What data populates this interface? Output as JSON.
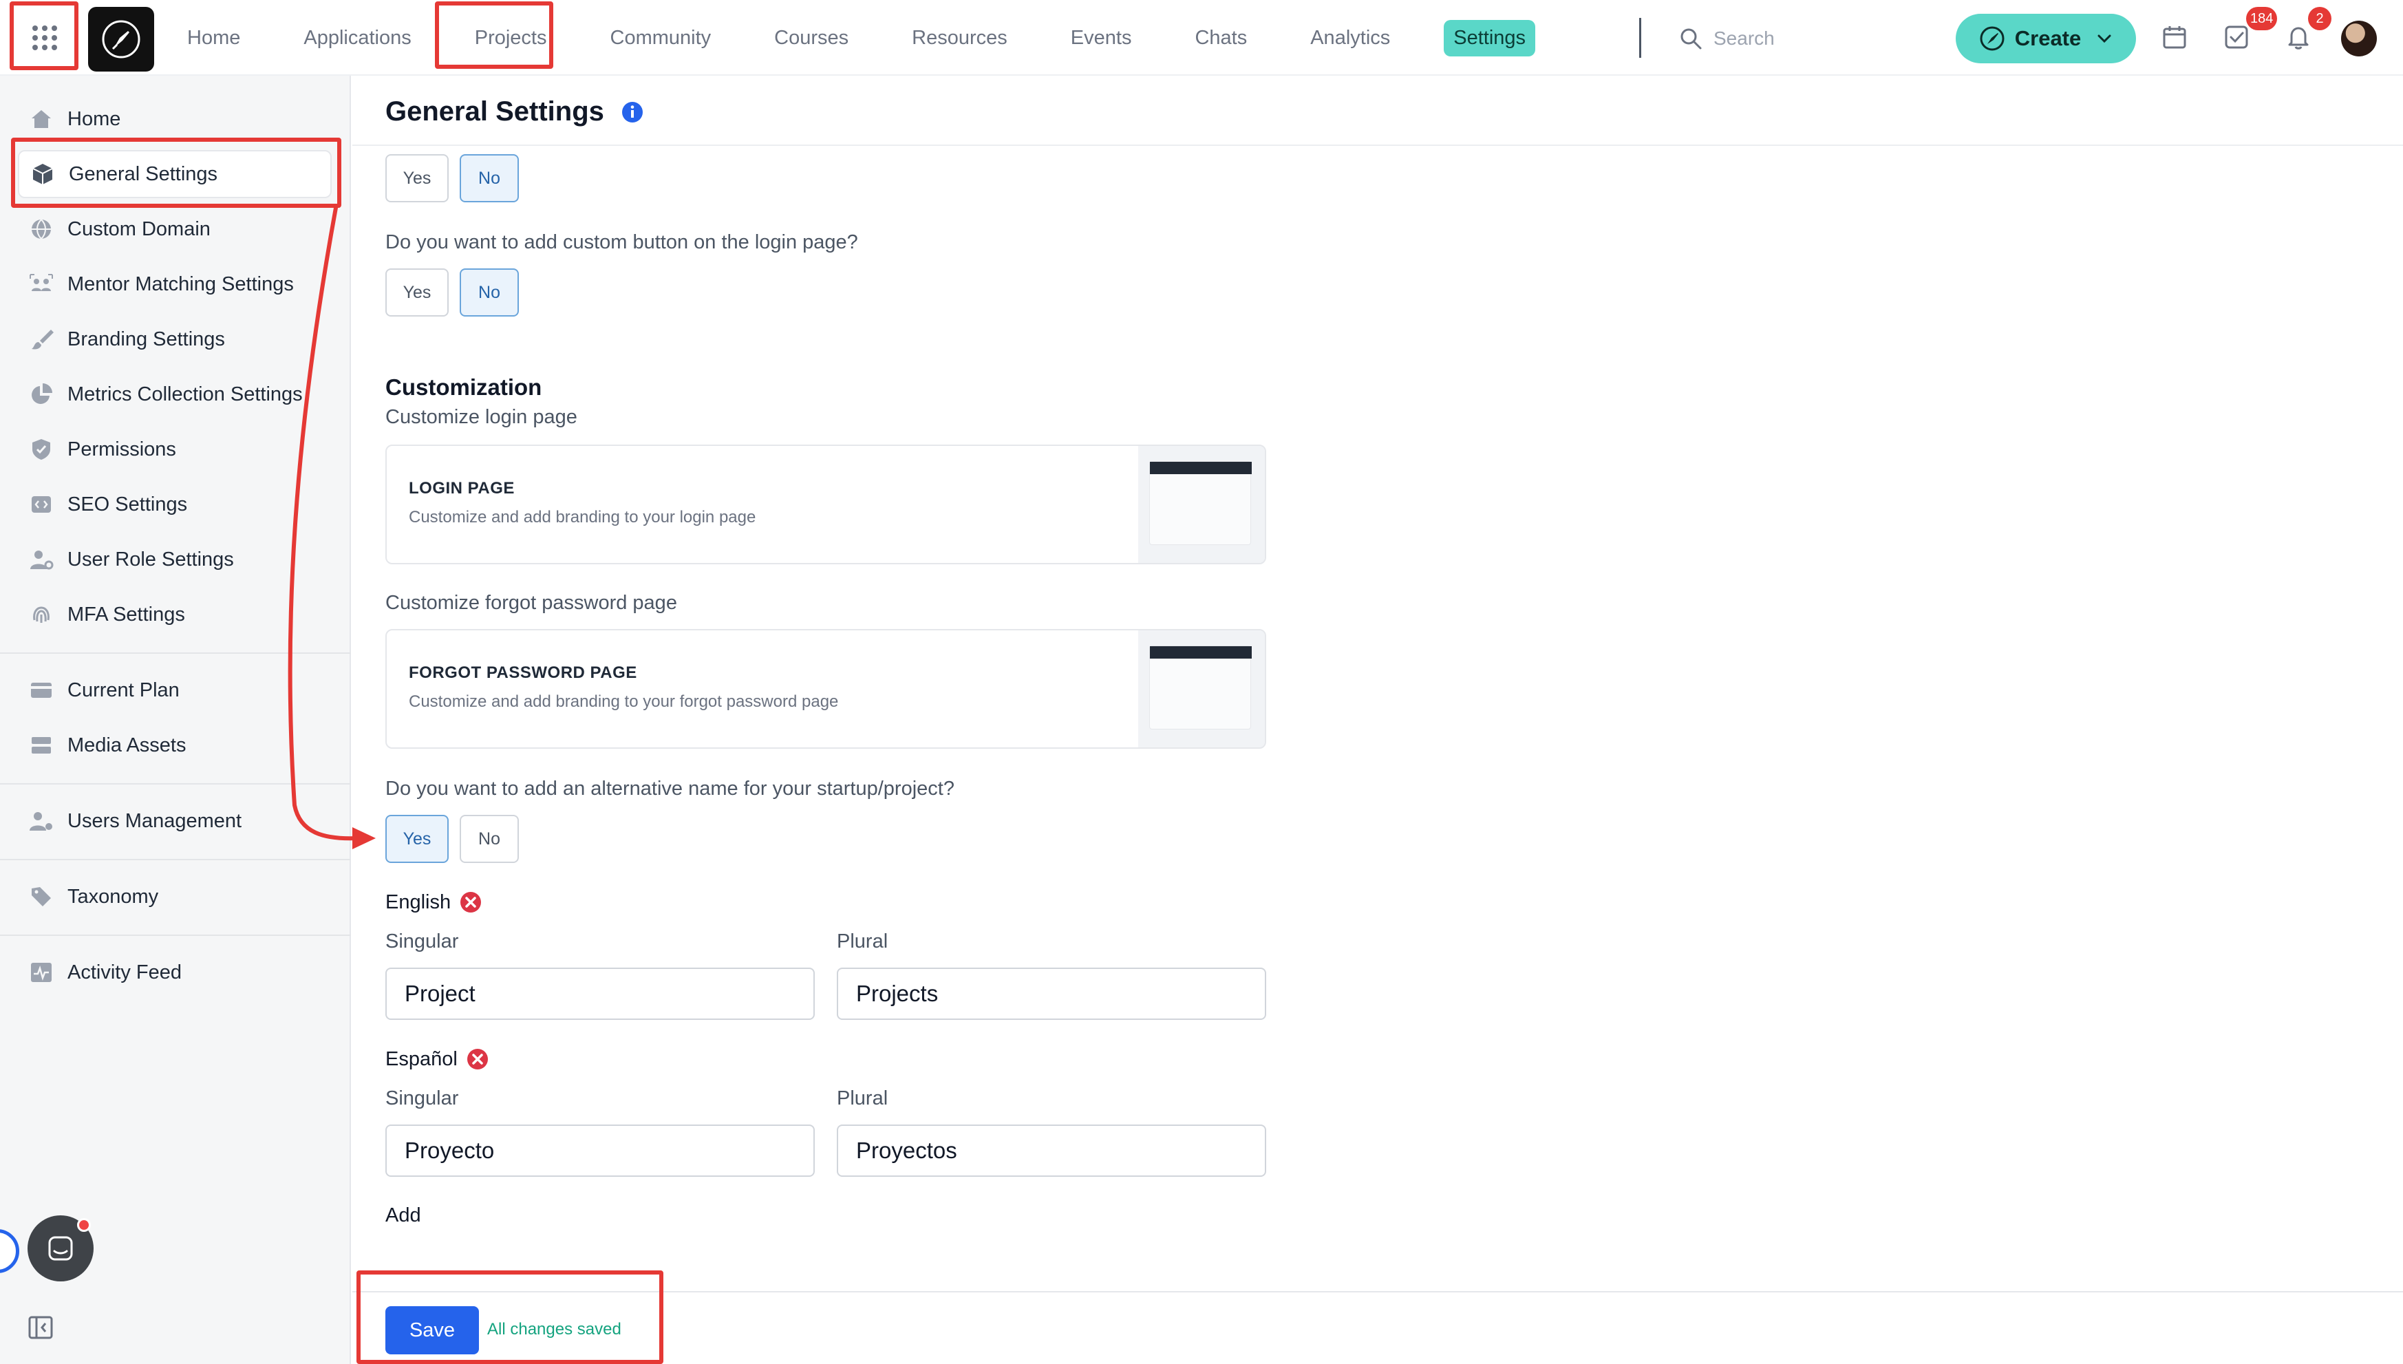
{
  "topbar": {
    "nav": [
      {
        "label": "Home"
      },
      {
        "label": "Applications"
      },
      {
        "label": "Projects"
      },
      {
        "label": "Community"
      },
      {
        "label": "Courses"
      },
      {
        "label": "Resources"
      },
      {
        "label": "Events"
      },
      {
        "label": "Chats"
      },
      {
        "label": "Analytics"
      },
      {
        "label": "Settings"
      }
    ],
    "active_nav": "Settings",
    "search_placeholder": "Search",
    "create_label": "Create",
    "tasks_badge": "184",
    "notifications_badge": "2",
    "accent_color": "#5ad7c8",
    "icons": [
      "app-grid-icon",
      "rocket-logo-icon",
      "search-icon",
      "create-icon",
      "chevron-down-icon",
      "calendar-icon",
      "tasks-icon",
      "bell-icon"
    ]
  },
  "sidebar": {
    "items": [
      {
        "label": "Home",
        "icon": "home-icon"
      },
      {
        "label": "General Settings",
        "icon": "cube-icon"
      },
      {
        "label": "Custom Domain",
        "icon": "globe-icon"
      },
      {
        "label": "Mentor Matching Settings",
        "icon": "users-match-icon"
      },
      {
        "label": "Branding Settings",
        "icon": "brush-icon"
      },
      {
        "label": "Metrics Collection Settings",
        "icon": "pie-chart-icon"
      },
      {
        "label": "Permissions",
        "icon": "shield-icon"
      },
      {
        "label": "SEO Settings",
        "icon": "code-icon"
      },
      {
        "label": "User Role Settings",
        "icon": "user-role-icon"
      },
      {
        "label": "MFA Settings",
        "icon": "fingerprint-icon"
      },
      {
        "label": "Current Plan",
        "icon": "card-icon"
      },
      {
        "label": "Media Assets",
        "icon": "server-icon"
      },
      {
        "label": "Users Management",
        "icon": "users-gear-icon"
      },
      {
        "label": "Taxonomy",
        "icon": "tag-icon"
      },
      {
        "label": "Activity Feed",
        "icon": "activity-icon"
      }
    ],
    "active_item": "General Settings"
  },
  "main": {
    "title": "General Settings",
    "q_custom_button": "Do you want to add custom button on the login page?",
    "yes": "Yes",
    "no": "No",
    "customization_title": "Customization",
    "customize_login": "Customize login page",
    "login_card": {
      "title": "LOGIN PAGE",
      "desc": "Customize and add branding to your login page"
    },
    "customize_forgot": "Customize forgot password page",
    "forgot_card": {
      "title": "FORGOT PASSWORD PAGE",
      "desc": "Customize and add branding to your forgot password page"
    },
    "q_alt_name": "Do you want to add an alternative name for your startup/project?",
    "languages": [
      {
        "name": "English",
        "singular_label": "Singular",
        "plural_label": "Plural",
        "singular": "Project",
        "plural": "Projects"
      },
      {
        "name": "Español",
        "singular_label": "Singular",
        "plural_label": "Plural",
        "singular": "Proyecto",
        "plural": "Proyectos"
      }
    ],
    "add_label": "Add"
  },
  "footer": {
    "save_label": "Save",
    "status": "All changes saved"
  }
}
